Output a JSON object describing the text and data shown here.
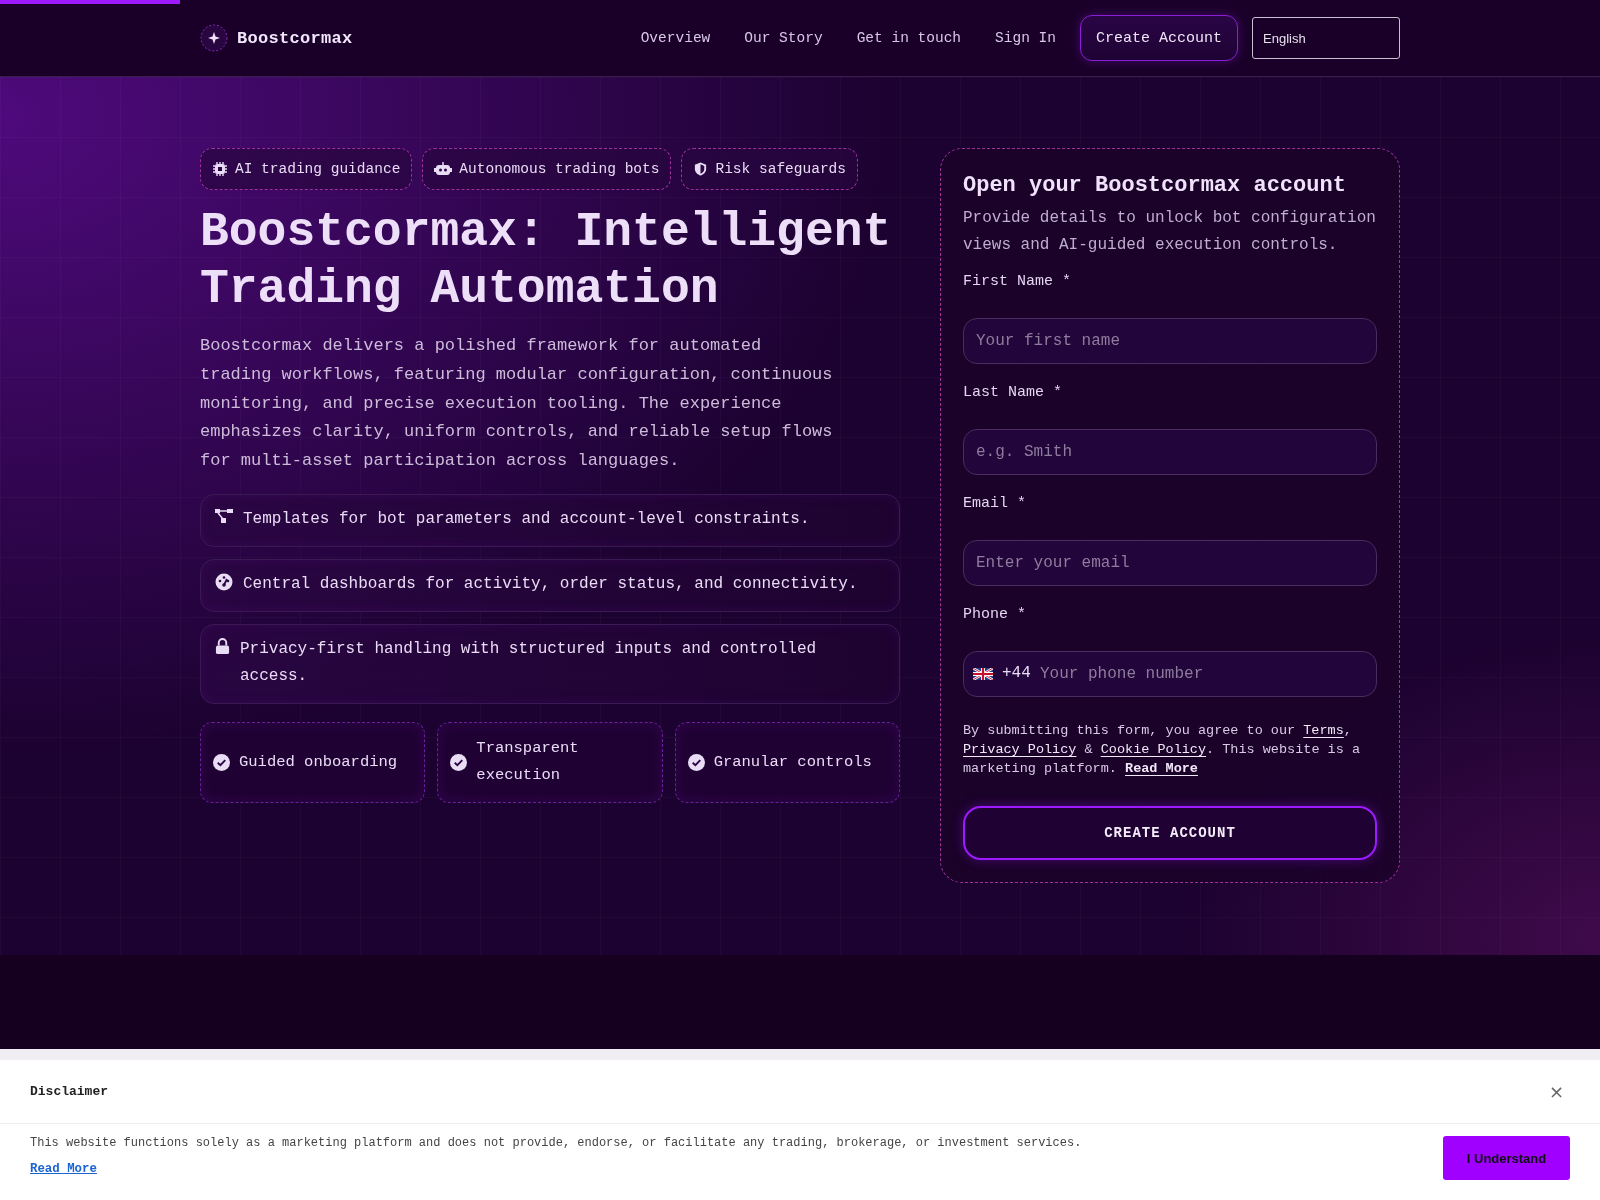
{
  "progress_bar": {
    "level": 0.1125
  },
  "header": {
    "brand": "Boostcormax",
    "nav": [
      {
        "label": "Overview"
      },
      {
        "label": "Our Story"
      },
      {
        "label": "Get in touch"
      },
      {
        "label": "Sign In"
      }
    ],
    "cta": "Create Account",
    "language": {
      "value": "English"
    }
  },
  "hero": {
    "chips": [
      {
        "label": "AI trading guidance"
      },
      {
        "label": "Autonomous trading bots"
      },
      {
        "label": "Risk safeguards"
      }
    ],
    "title": "Boostcormax: Intelligent Trading Automation",
    "description": "Boostcormax delivers a polished framework for automated trading workflows, featuring modular configuration, continuous monitoring, and precise execution tooling. The experience emphasizes clarity, uniform controls, and reliable setup flows for multi-asset participation across languages.",
    "features": [
      "Templates for bot parameters and account-level constraints.",
      "Central dashboards for activity, order status, and connectivity.",
      "Privacy-first handling with structured inputs and controlled access."
    ],
    "highlights": [
      "Guided onboarding",
      "Transparent execution",
      "Granular controls"
    ]
  },
  "form": {
    "title": "Open your Boostcormax account",
    "subtitle": "Provide details to unlock bot configuration views and AI-guided execution controls.",
    "fields": [
      {
        "kind": "text",
        "label": "First Name *",
        "placeholder": "Your first name"
      },
      {
        "kind": "text",
        "label": "Last Name *",
        "placeholder": "e.g. Smith"
      },
      {
        "kind": "text",
        "label": "Email *",
        "placeholder": "Enter your email"
      },
      {
        "kind": "phone",
        "label": "Phone *",
        "prefix": "+44",
        "placeholder": "Your phone number"
      }
    ],
    "consent": [
      {
        "kind": "text",
        "text": "By submitting this form, you agree to our "
      },
      {
        "kind": "link",
        "text": "Terms"
      },
      {
        "kind": "text",
        "text": ", "
      },
      {
        "kind": "link",
        "text": "Privacy Policy"
      },
      {
        "kind": "text",
        "text": " & "
      },
      {
        "kind": "link",
        "text": "Cookie Policy"
      },
      {
        "kind": "text",
        "text": ". This website is a marketing platform. "
      },
      {
        "kind": "bold-link",
        "text": "Read More"
      }
    ],
    "submit": "CREATE ACCOUNT"
  },
  "disclaimer": {
    "title": "Disclaimer",
    "close": "×",
    "text": "This website functions solely as a marketing platform and does not provide, endorse, or facilitate any trading, brokerage, or investment services.",
    "read_more": "Read More",
    "button": "I Understand"
  }
}
